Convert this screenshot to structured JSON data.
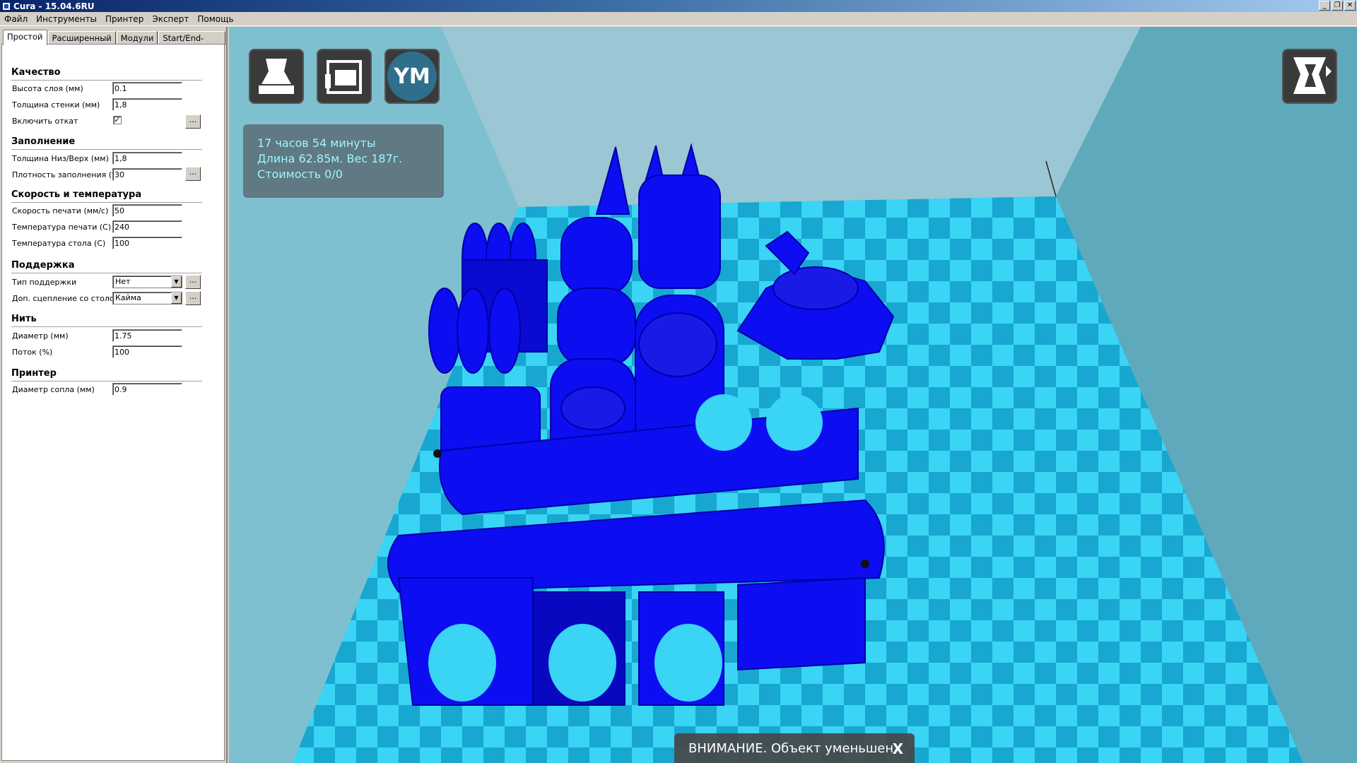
{
  "window": {
    "title": "Cura - 15.04.6RU",
    "controls": [
      "_",
      "❐",
      "✕"
    ]
  },
  "menu": [
    "Файл",
    "Инструменты",
    "Принтер",
    "Эксперт",
    "Помощь"
  ],
  "tabs": [
    "Простой",
    "Расширенный",
    "Модули",
    "Start/End-GCode"
  ],
  "sections": {
    "quality": {
      "title": "Качество",
      "layer_height_label": "Высота слоя (мм)",
      "layer_height": "0.1",
      "wall_label": "Толщина стенки (мм)",
      "wall": "1,8",
      "retraction_label": "Включить откат",
      "retraction_checked": "✓"
    },
    "fill": {
      "title": "Заполнение",
      "bottom_top_label": "Толщина Низ/Верх (мм)",
      "bottom_top": "1,8",
      "density_label": "Плотность заполнения (%)",
      "density": "30"
    },
    "speed": {
      "title": "Скорость и температура",
      "print_speed_label": "Скорость печати (мм/с)",
      "print_speed": "50",
      "print_temp_label": "Температура печати (С)",
      "print_temp": "240",
      "bed_temp_label": "Температура стола (С)",
      "bed_temp": "100"
    },
    "support": {
      "title": "Поддержка",
      "type_label": "Тип поддержки",
      "type": "Нет",
      "adhesion_label": "Доп. сцепление со столом",
      "adhesion": "Кайма"
    },
    "filament": {
      "title": "Нить",
      "diameter_label": "Диаметр (мм)",
      "diameter": "1.75",
      "flow_label": "Поток (%)",
      "flow": "100"
    },
    "printer": {
      "title": "Принтер",
      "nozzle_label": "Диаметр сопла (мм)",
      "nozzle": "0.9"
    }
  },
  "dots_label": "...",
  "dropdown_arrow": "▼",
  "info": {
    "time": "17 часов 54 минуты",
    "length_weight": "Длина 62.85м. Вес 187г.",
    "cost": "Стоимость 0/0"
  },
  "toolbar": {
    "load_icon": "load-model-icon",
    "printer_icon": "printer-icon",
    "ym_label": "YM"
  },
  "warning": {
    "text": "ВНИМАНИЕ. Объект уменьшен.",
    "close": "X"
  },
  "colors": {
    "model": "#0d0df2",
    "bed_light": "#3ad4f5",
    "bed_dark": "#17a7d0",
    "accent_text": "#9ef6ff"
  }
}
